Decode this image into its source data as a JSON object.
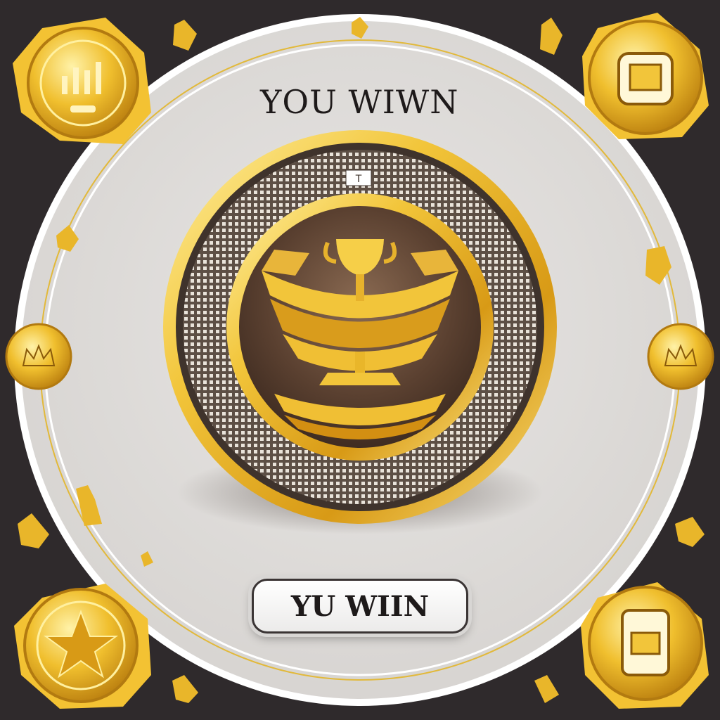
{
  "header": {
    "title": "YOU  WIWN"
  },
  "action": {
    "button_label": "YU WIIN"
  },
  "trophy_badge": {
    "tag": "T"
  },
  "palette": {
    "background": "#2f2a2c",
    "panel": "#e3e1df",
    "gold_light": "#ffe27a",
    "gold": "#e9b62a",
    "gold_dark": "#9c6a0e",
    "inner_brown": "#5a4030"
  },
  "icons": {
    "top_left": "chart-coin-icon",
    "top_right": "device-coin-icon",
    "bottom_left": "star-coin-icon",
    "bottom_right": "card-coin-icon",
    "left_mid": "crown-coin-icon",
    "right_mid": "crown-coin-icon",
    "center": "trophy-icon"
  }
}
